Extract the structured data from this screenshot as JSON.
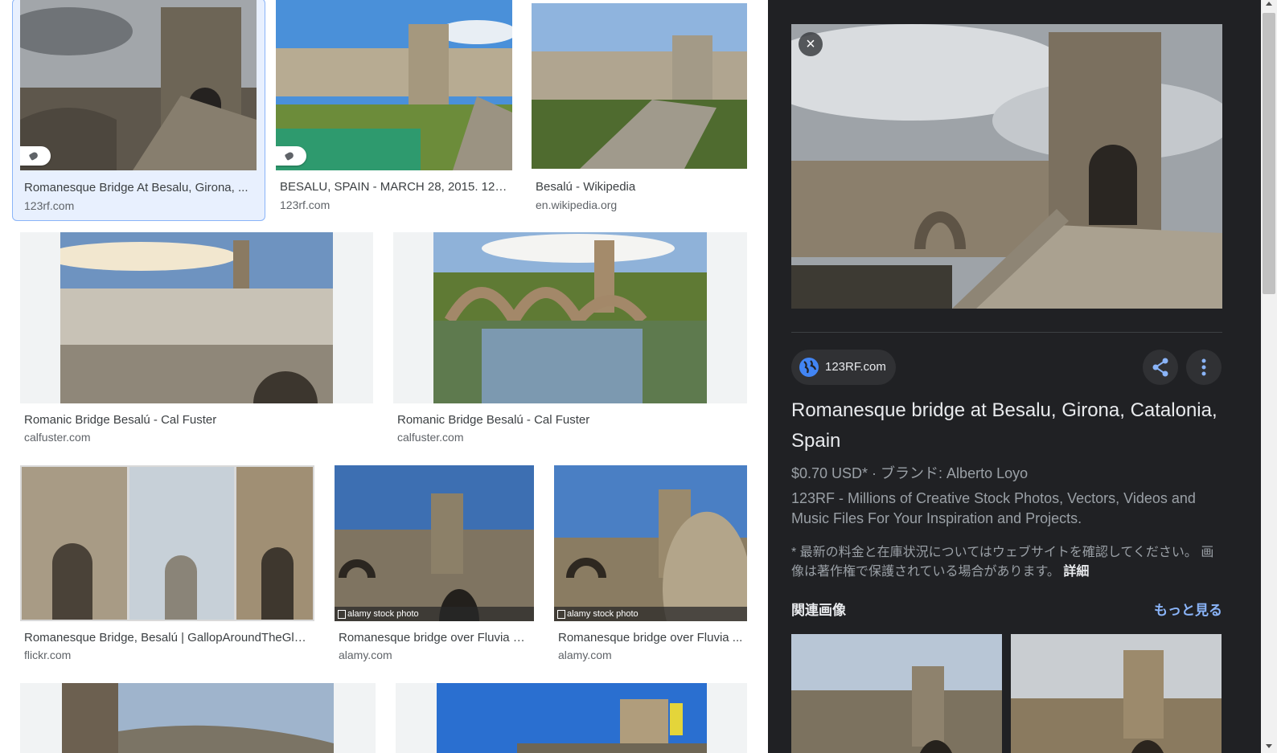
{
  "results": [
    {
      "title": "Romanesque Bridge At Besalu, Girona, ...",
      "site": "123rf.com"
    },
    {
      "title": "BESALU, SPAIN - MARCH 28, 2015. 12th...",
      "site": "123rf.com"
    },
    {
      "title": "Besalú - Wikipedia",
      "site": "en.wikipedia.org"
    },
    {
      "title": "Romanic Bridge Besalú - Cal Fuster",
      "site": "calfuster.com"
    },
    {
      "title": "Romanic Bridge Besalú - Cal Fuster",
      "site": "calfuster.com"
    },
    {
      "title": "Romanesque Bridge, Besalú | GallopAroundTheGlo...",
      "site": "flickr.com"
    },
    {
      "title": "Romanesque bridge over Fluvia R...",
      "site": "alamy.com",
      "watermark": "alamy stock photo"
    },
    {
      "title": "Romanesque bridge over Fluvia ...",
      "site": "alamy.com",
      "watermark": "alamy stock photo"
    }
  ],
  "panel": {
    "close_label": "×",
    "source": "123RF.com",
    "title": "Romanesque bridge at Besalu, Girona, Catalonia, Spain",
    "price": "$0.70 USD* · ブランド: Alberto Loyo",
    "description": "123RF - Millions of Creative Stock Photos, Vectors, Videos and Music Files For Your Inspiration and Projects.",
    "note": "* 最新の料金と在庫状況についてはウェブサイトを確認してください。 画像は著作権で保護されている場合があります。",
    "note_link": "詳細",
    "related_heading": "関連画像",
    "more_link": "もっと見る"
  },
  "colors": {
    "accent": "#8ab4f8",
    "panel_bg": "#202124",
    "selected_bg": "#e8f0fe"
  },
  "icons": [
    "tag-icon",
    "close-icon",
    "globe-icon",
    "share-icon",
    "more-vert-icon"
  ]
}
